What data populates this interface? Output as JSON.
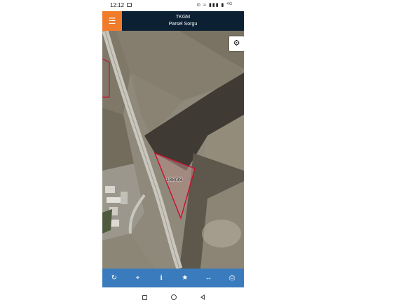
{
  "status": {
    "time": "12:12",
    "indicators": "⊙ ≈ ▮▮▮ ▮",
    "network": "4G"
  },
  "header": {
    "menu_icon": "☰",
    "title": "TKGM",
    "subtitle": "Parsel Sorgu"
  },
  "map": {
    "settings_icon": "⚙",
    "parcel_label": "188/39",
    "parcel_outline_color": "#c8102e"
  },
  "toolbar": {
    "refresh_icon": "↻",
    "locate_icon": "⌖",
    "info_icon": "i",
    "favorite_icon": "★",
    "measure_icon": "↔",
    "print_icon": "⎙"
  },
  "navbar": {
    "recents": "",
    "home": "",
    "back": ""
  },
  "colors": {
    "appbar": "#0b2033",
    "menu_accent": "#f07c2b",
    "toolbar": "#3a7bbd"
  }
}
